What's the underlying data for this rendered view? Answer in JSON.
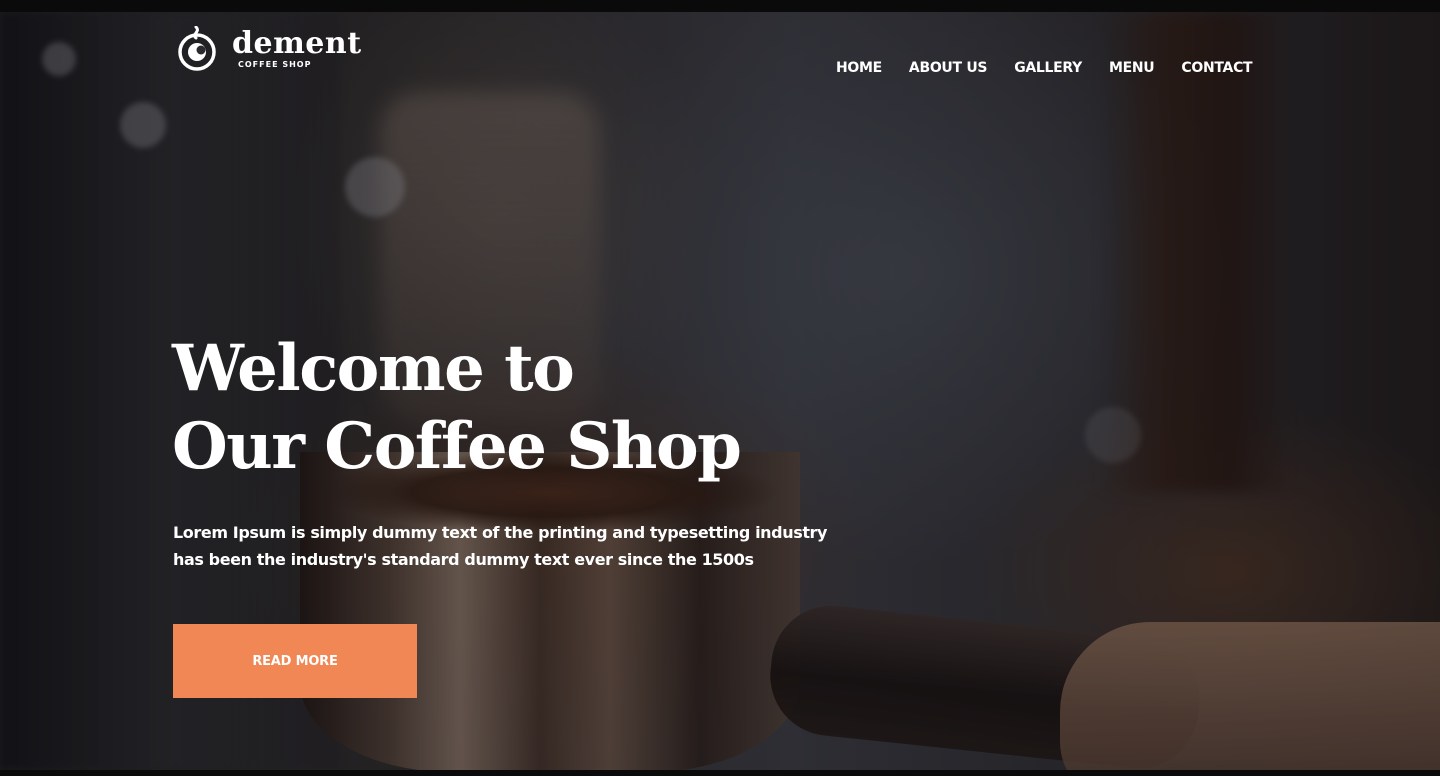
{
  "brand": {
    "name": "dement",
    "tagline": "COFFEE SHOP",
    "logo_icon": "coffee-cup-icon"
  },
  "nav": {
    "items": [
      {
        "label": "HOME"
      },
      {
        "label": "ABOUT US"
      },
      {
        "label": "GALLERY"
      },
      {
        "label": "MENU"
      },
      {
        "label": "CONTACT"
      }
    ]
  },
  "hero": {
    "title_line1": "Welcome to",
    "title_line2": "Our Coffee Shop",
    "text_line1": "Lorem Ipsum is simply dummy text of the printing and typesetting industry",
    "text_line2": "has been the industry's standard dummy text ever since the 1500s",
    "cta_label": "READ MORE"
  },
  "colors": {
    "accent": "#f08755",
    "text": "#ffffff"
  }
}
